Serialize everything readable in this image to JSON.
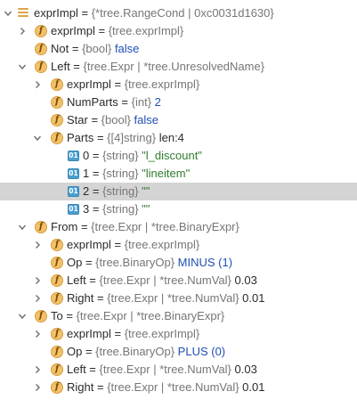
{
  "tree": {
    "rows": [
      {
        "name": "",
        "eq": "",
        "type": "",
        "value": ""
      },
      {
        "name": "exprImpl",
        "eq": " = ",
        "type": "{*tree.RangeCond | 0xc0031d1630}",
        "value": ""
      },
      {
        "name": "exprImpl",
        "eq": " = ",
        "type": "{tree.exprImpl}",
        "value": ""
      },
      {
        "name": "Not",
        "eq": " = ",
        "type": "{bool} ",
        "value": "false"
      },
      {
        "name": "Left",
        "eq": " = ",
        "type": "{tree.Expr | *tree.UnresolvedName}",
        "value": ""
      },
      {
        "name": "exprImpl",
        "eq": " = ",
        "type": "{tree.exprImpl}",
        "value": ""
      },
      {
        "name": "NumParts",
        "eq": " = ",
        "type": "{int} ",
        "value": "2"
      },
      {
        "name": "Star",
        "eq": " = ",
        "type": "{bool} ",
        "value": "false"
      },
      {
        "name": "Parts",
        "eq": " = ",
        "type": "{[4]string} ",
        "value": "len:4"
      },
      {
        "name": "0",
        "eq": " = ",
        "type": "{string} ",
        "value": "\"l_discount\""
      },
      {
        "name": "1",
        "eq": " = ",
        "type": "{string} ",
        "value": "\"lineitem\""
      },
      {
        "name": "2",
        "eq": " = ",
        "type": "{string} ",
        "value": "\"\""
      },
      {
        "name": "3",
        "eq": " = ",
        "type": "{string} ",
        "value": "\"\""
      },
      {
        "name": "From",
        "eq": " = ",
        "type": "{tree.Expr | *tree.BinaryExpr}",
        "value": ""
      },
      {
        "name": "exprImpl",
        "eq": " = ",
        "type": "{tree.exprImpl}",
        "value": ""
      },
      {
        "name": "Op",
        "eq": " = ",
        "type": "{tree.BinaryOp} ",
        "value": "MINUS (1)"
      },
      {
        "name": "Left",
        "eq": " = ",
        "type": "{tree.Expr | *tree.NumVal} ",
        "value": "0.03"
      },
      {
        "name": "Right",
        "eq": " = ",
        "type": "{tree.Expr | *tree.NumVal} ",
        "value": "0.01"
      },
      {
        "name": "To",
        "eq": " = ",
        "type": "{tree.Expr | *tree.BinaryExpr}",
        "value": ""
      },
      {
        "name": "exprImpl",
        "eq": " = ",
        "type": "{tree.exprImpl}",
        "value": ""
      },
      {
        "name": "Op",
        "eq": " = ",
        "type": "{tree.BinaryOp} ",
        "value": "PLUS (0)"
      },
      {
        "name": "Left",
        "eq": " = ",
        "type": "{tree.Expr | *tree.NumVal} ",
        "value": "0.03"
      },
      {
        "name": "Right",
        "eq": " = ",
        "type": "{tree.Expr | *tree.NumVal} ",
        "value": "0.01"
      }
    ]
  },
  "icons": {
    "field_letter": "f",
    "index_label": "01"
  },
  "colors": {
    "selected_row": "#d4d4d4",
    "field_icon": "#f2c26b",
    "index_icon": "#4a9fd0",
    "value_blue": "#1f4fb5",
    "string_green": "#2f7d2f"
  }
}
